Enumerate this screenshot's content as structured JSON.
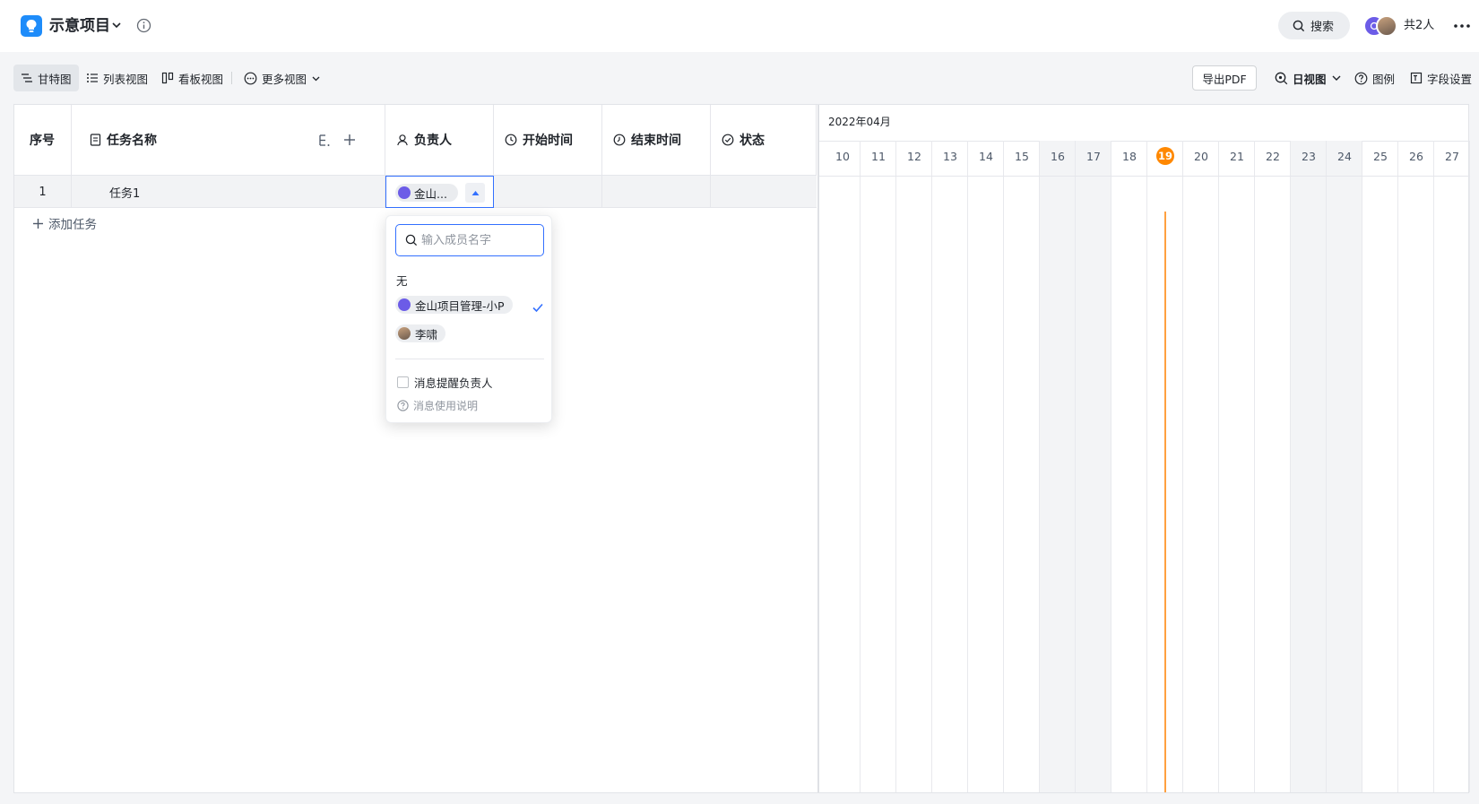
{
  "header": {
    "project_title": "示意项目",
    "search_label": "搜索",
    "member_count": "共2人"
  },
  "views": {
    "gantt": "甘特图",
    "list": "列表视图",
    "board": "看板视图",
    "more": "更多视图"
  },
  "toolbar": {
    "export_pdf": "导出PDF",
    "day_view": "日视图",
    "legend": "图例",
    "field_settings": "字段设置"
  },
  "table": {
    "columns": {
      "index": "序号",
      "task_name": "任务名称",
      "assignee": "负责人",
      "start": "开始时间",
      "end": "结束时间",
      "status": "状态"
    },
    "rows": [
      {
        "index": "1",
        "name": "任务1",
        "assignee": "金山..."
      }
    ],
    "add_task": "添加任务"
  },
  "gantt": {
    "month": "2022年04月",
    "days": [
      "10",
      "11",
      "12",
      "13",
      "14",
      "15",
      "16",
      "17",
      "18",
      "19",
      "20",
      "21",
      "22",
      "23",
      "24",
      "25",
      "26",
      "27"
    ],
    "weekend_days": [
      "16",
      "17",
      "23",
      "24"
    ],
    "today": "19",
    "today_color": "#ff8800"
  },
  "assignee_dropdown": {
    "search_placeholder": "输入成员名字",
    "none_label": "无",
    "members": [
      {
        "name": "金山项目管理-小P",
        "selected": true
      },
      {
        "name": "李啸",
        "selected": false
      }
    ],
    "notify_label": "消息提醒负责人",
    "help_label": "消息使用说明"
  },
  "colors": {
    "accent": "#3370ff",
    "logo": "#1e8cfa"
  }
}
